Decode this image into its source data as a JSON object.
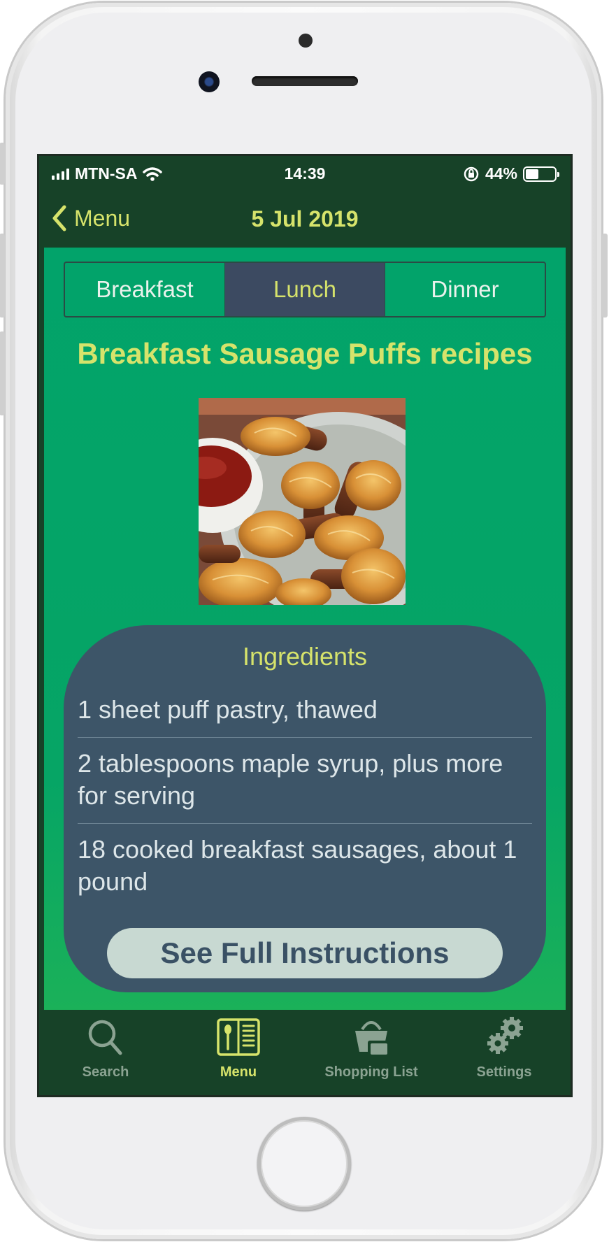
{
  "status_bar": {
    "carrier": "MTN-SA",
    "time": "14:39",
    "battery_percent": "44%",
    "battery_level": 0.44
  },
  "nav": {
    "back_label": "Menu",
    "title": "5 Jul 2019"
  },
  "meal_tabs": [
    {
      "label": "Breakfast",
      "selected": false
    },
    {
      "label": "Lunch",
      "selected": true
    },
    {
      "label": "Dinner",
      "selected": false
    }
  ],
  "recipe": {
    "title": "Breakfast Sausage Puffs recipes",
    "ingredients_heading": "Ingredients",
    "ingredients": [
      "1 sheet puff pastry, thawed",
      "2 tablespoons maple syrup, plus more for serving",
      "18 cooked breakfast sausages, about 1 pound"
    ],
    "instructions_button": "See Full Instructions"
  },
  "tab_bar": [
    {
      "label": "Search",
      "icon": "search-icon",
      "selected": false
    },
    {
      "label": "Menu",
      "icon": "menu-book-icon",
      "selected": true
    },
    {
      "label": "Shopping List",
      "icon": "shopping-basket-icon",
      "selected": false
    },
    {
      "label": "Settings",
      "icon": "gears-icon",
      "selected": false
    }
  ],
  "colors": {
    "nav_background": "#174228",
    "content_green": "#02a36a",
    "accent_yellow": "#d6e36b",
    "card_slate": "#3d5568",
    "selected_segment": "#3c4a61",
    "button_light": "#c8d9d2"
  }
}
